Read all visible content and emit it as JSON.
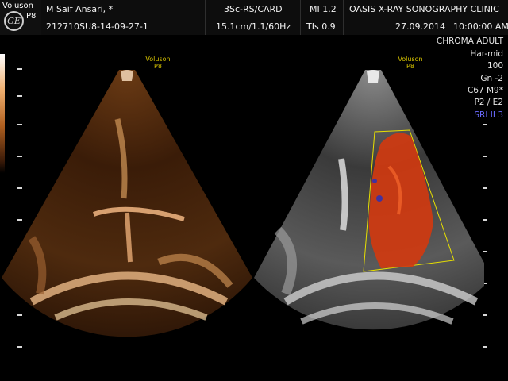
{
  "brand": {
    "name": "Voluson",
    "probe": "P8",
    "logo": "GE"
  },
  "header": {
    "patient_name": "M Saif Ansari,  *",
    "patient_id": "212710SU8-14-09-27-1",
    "probe_mode": "3Sc-RS/CARD",
    "depth_info": "15.1cm/1.1/60Hz",
    "mi": "MI  1.2",
    "tis": "TIs  0.9",
    "clinic": "OASIS X-RAY SONOGRAPHY CLINIC",
    "date": "27.09.2014",
    "time": "10:00:00 AM"
  },
  "left_image": {
    "mark_brand": "Voluson",
    "mark_probe": "P8",
    "tint": "#c07830"
  },
  "right_image": {
    "mark_brand": "Voluson",
    "mark_probe": "P8",
    "flow_color": "#d03a10",
    "box_color": "#e8e000"
  },
  "right_panel": {
    "lines": [
      "CHROMA ADULT",
      "Har-mid",
      "100 ",
      "Gn  -2",
      "C67 M9*",
      "P2 / E2",
      "SRI II 3"
    ],
    "sri_color": "#6a6aff"
  }
}
